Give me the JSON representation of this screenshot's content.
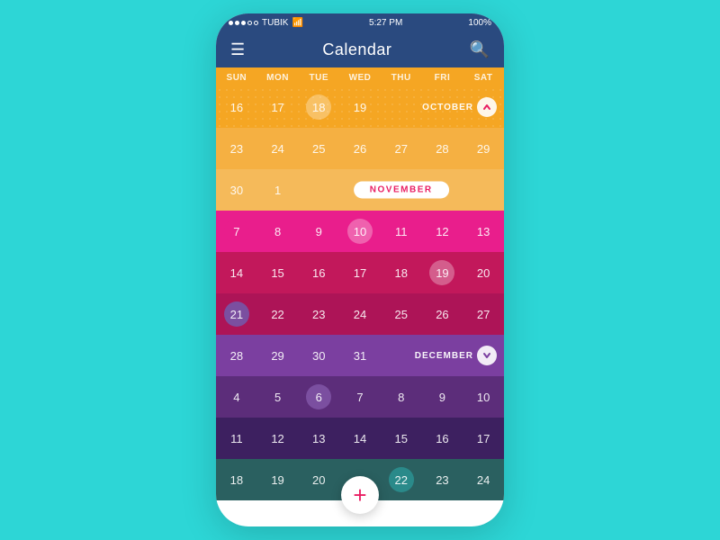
{
  "statusBar": {
    "carrier": "TUBIK",
    "time": "5:27 PM",
    "battery": "100%"
  },
  "header": {
    "title": "Calendar",
    "menuIcon": "☰",
    "searchIcon": "🔍"
  },
  "dayHeaders": [
    "SUN",
    "MON",
    "TUE",
    "WED",
    "THU",
    "FRI",
    "SAT"
  ],
  "rows": [
    {
      "colorClass": "row-oct1",
      "cells": [
        "16",
        "17",
        "18",
        "19",
        "",
        "",
        ""
      ],
      "monthLabel": "OCTOBER",
      "monthDir": "up",
      "specialCells": {
        "2": "circle-white"
      }
    },
    {
      "colorClass": "row-oct2",
      "cells": [
        "23",
        "24",
        "25",
        "26",
        "27",
        "28",
        "29"
      ],
      "specialCells": {}
    },
    {
      "colorClass": "row-oct3",
      "cells": [
        "30",
        "1",
        "",
        "",
        "",
        "",
        ""
      ],
      "monthLabel": "NOVEMBER",
      "specialCells": {}
    },
    {
      "colorClass": "row-nov2",
      "cells": [
        "7",
        "8",
        "9",
        "10",
        "11",
        "12",
        "13"
      ],
      "specialCells": {
        "0": "circle-pink",
        "3": "circle-white"
      }
    },
    {
      "colorClass": "row-nov3",
      "cells": [
        "14",
        "15",
        "16",
        "17",
        "18",
        "19",
        "20"
      ],
      "specialCells": {
        "5": "circle-white"
      }
    },
    {
      "colorClass": "row-nov4",
      "cells": [
        "21",
        "22",
        "23",
        "24",
        "25",
        "26",
        "27"
      ],
      "specialCells": {
        "0": "circle-purple"
      }
    },
    {
      "colorClass": "row-dec1",
      "cells": [
        "28",
        "29",
        "30",
        "31",
        "",
        "",
        ""
      ],
      "monthLabel": "DECEMBER",
      "monthDir": "down",
      "specialCells": {}
    },
    {
      "colorClass": "row-dec2",
      "cells": [
        "4",
        "5",
        "6",
        "7",
        "8",
        "9",
        "10"
      ],
      "specialCells": {
        "2": "circle-purple"
      }
    },
    {
      "colorClass": "row-dec3",
      "cells": [
        "11",
        "12",
        "13",
        "14",
        "15",
        "16",
        "17"
      ],
      "specialCells": {}
    },
    {
      "colorClass": "row-dec4",
      "cells": [
        "18",
        "19",
        "20",
        "",
        "22",
        "23",
        "24"
      ],
      "specialCells": {
        "4": "circle-teal"
      }
    }
  ]
}
